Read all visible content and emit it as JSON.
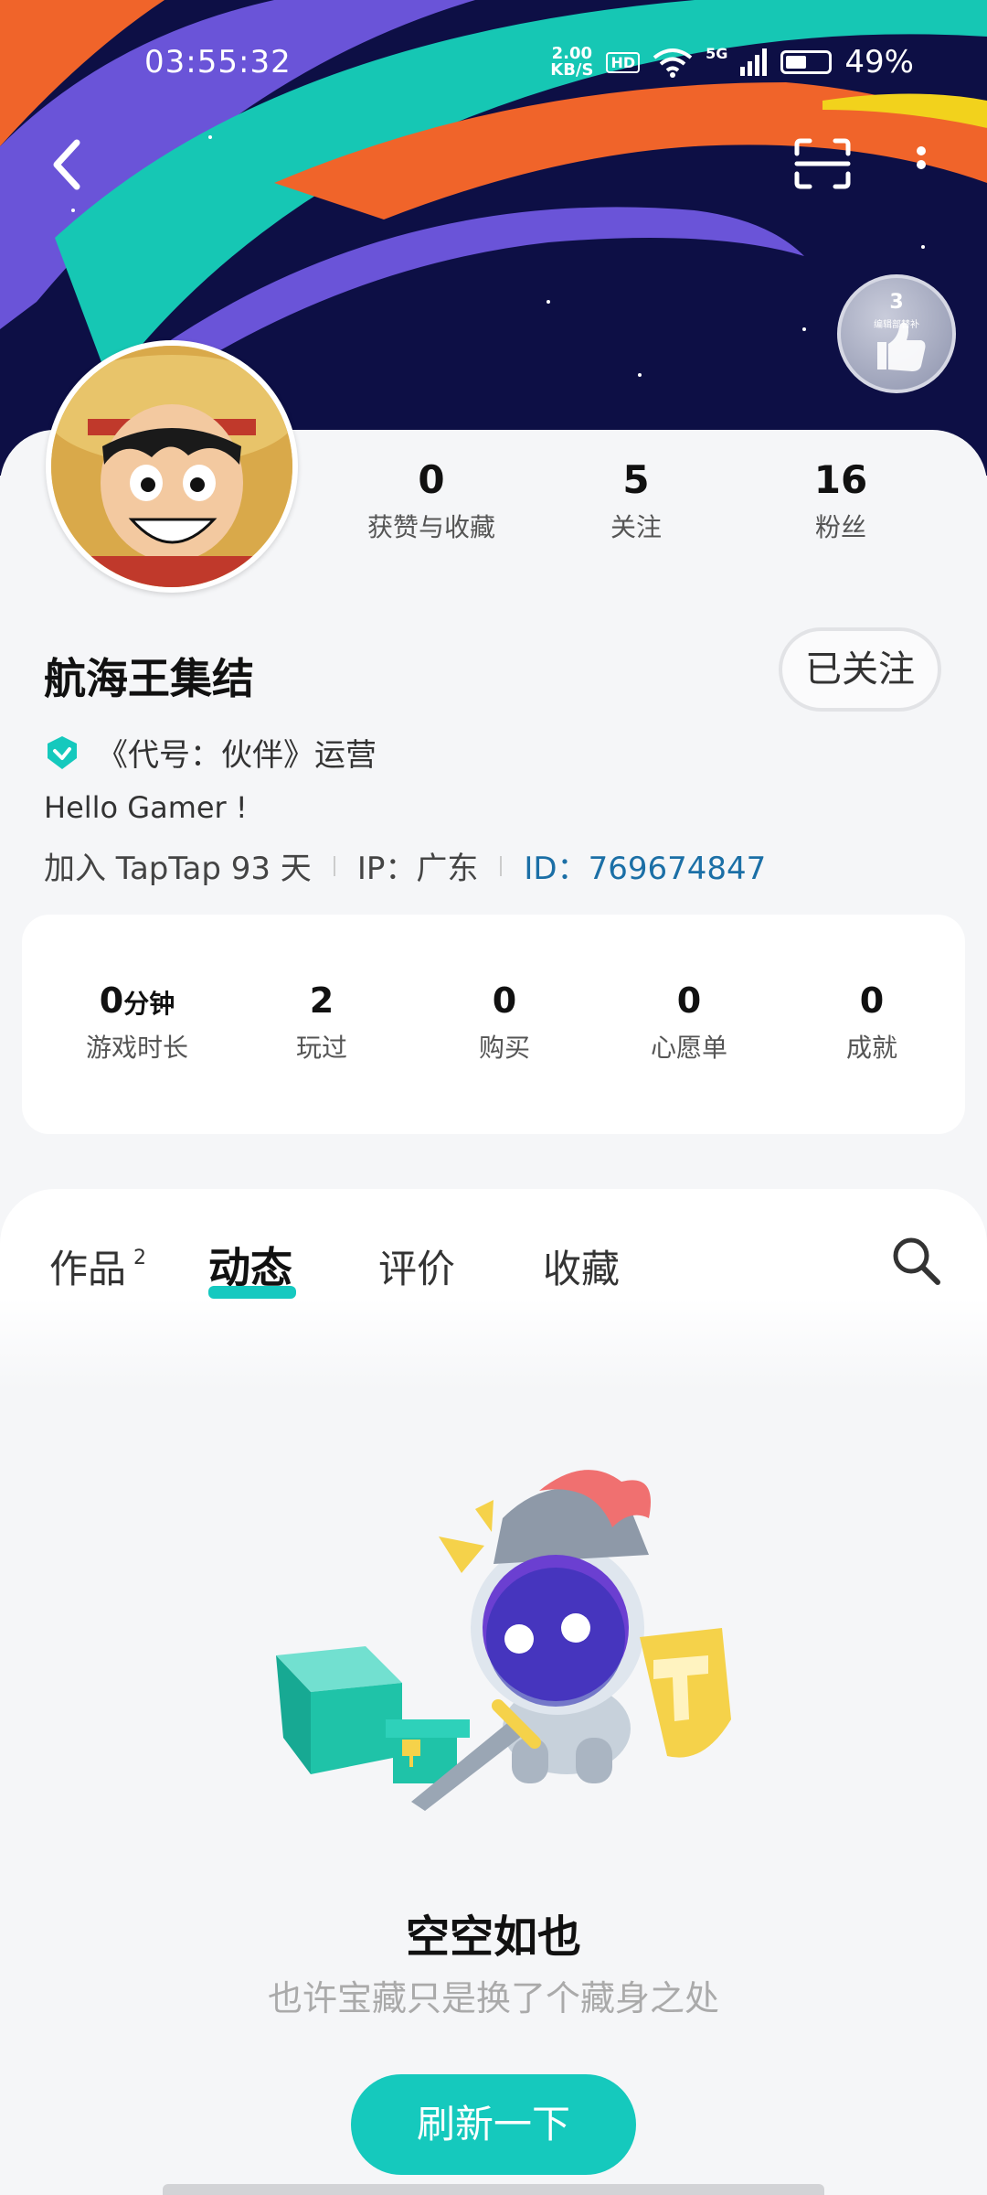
{
  "status_bar": {
    "time": "03:55:32",
    "net_speed_value": "2.00",
    "net_speed_unit": "KB/S",
    "hd": "HD",
    "net_type": "5G",
    "battery": "49%",
    "battery_level": 0.49
  },
  "header": {
    "badge_number": "3",
    "badge_text": "编辑部替补"
  },
  "profile": {
    "stats": [
      {
        "value": "0",
        "label": "获赞与收藏"
      },
      {
        "value": "5",
        "label": "关注"
      },
      {
        "value": "16",
        "label": "粉丝"
      }
    ],
    "username": "航海王集结",
    "follow_label": "已关注",
    "verification": "《代号：伙伴》运营",
    "bio": "Hello Gamer !",
    "joined": "加入 TapTap 93 天",
    "ip": "IP：广东",
    "id_label": "ID：",
    "id_value": "769674847"
  },
  "game_stats": [
    {
      "value": "0",
      "unit": "分钟",
      "label": "游戏时长"
    },
    {
      "value": "2",
      "unit": "",
      "label": "玩过"
    },
    {
      "value": "0",
      "unit": "",
      "label": "购买"
    },
    {
      "value": "0",
      "unit": "",
      "label": "心愿单"
    },
    {
      "value": "0",
      "unit": "",
      "label": "成就"
    }
  ],
  "tabs": [
    {
      "label": "作品",
      "count": "2"
    },
    {
      "label": "动态",
      "active": true
    },
    {
      "label": "评价"
    },
    {
      "label": "收藏"
    }
  ],
  "empty_state": {
    "title": "空空如也",
    "subtitle": "也许宝藏只是换了个藏身之处",
    "button": "刷新一下"
  },
  "colors": {
    "accent": "#15c9bd",
    "banner_bg": "#0d0f45",
    "link": "#1b6fa6"
  }
}
